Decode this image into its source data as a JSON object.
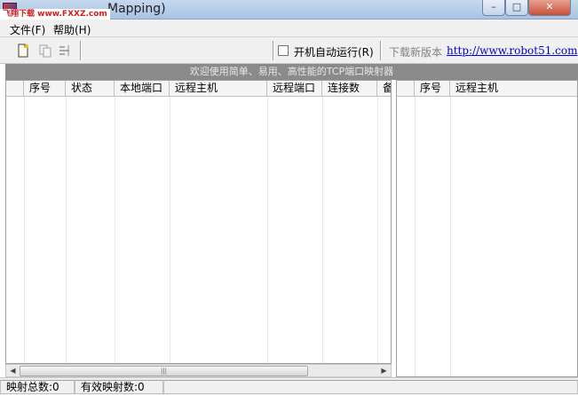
{
  "window": {
    "title": "Mapping)",
    "badge": "飞翔下载 www.FXXZ.com",
    "minimize_glyph": "–",
    "maximize_glyph": "□",
    "close_glyph": "✕"
  },
  "menu": {
    "file": "文件(F)",
    "help": "帮助(H)"
  },
  "toolbar": {
    "autorun_label": "开机自动运行(R)",
    "autorun_checked": false,
    "download_label": "下载新版本",
    "download_link": "http://www.robot51.com"
  },
  "banner": "欢迎使用简单、易用、高性能的TCP端口映射器",
  "left_table": {
    "columns": [
      "序号",
      "状态",
      "本地端口",
      "远程主机",
      "远程端口",
      "连接数",
      "备注"
    ],
    "rows": []
  },
  "right_table": {
    "columns": [
      "序号",
      "远程主机"
    ],
    "rows": []
  },
  "scrollbar": {
    "left_arrow": "◀",
    "right_arrow": "▶",
    "thumb_grip": "|||"
  },
  "status": {
    "total": "映射总数:0",
    "active": "有效映射数:0"
  }
}
